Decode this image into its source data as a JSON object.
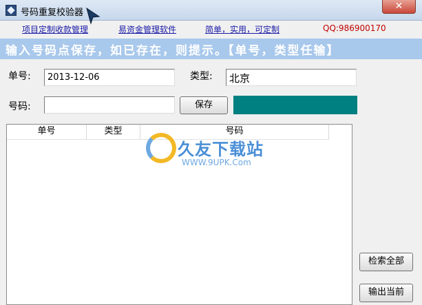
{
  "window": {
    "title": "号码重复校验器",
    "close_symbol": "✕"
  },
  "links": {
    "custom": "项目定制收款管理",
    "finance": "易资金管理软件",
    "slogan": "简单，实用，可定制",
    "qq": "QQ:986900170"
  },
  "banner": "输入号码点保存，如已存在，则提示。【单号，类型任输】",
  "form": {
    "order_label": "单号:",
    "order_value": "2013-12-06",
    "type_label": "类型:",
    "type_value": "北京",
    "number_label": "号码:",
    "number_value": "",
    "save_button": "保存"
  },
  "table": {
    "columns": [
      "单号",
      "类型",
      "号码"
    ]
  },
  "buttons": {
    "search_all": "检索全部",
    "export_current": "输出当前"
  },
  "watermark": {
    "text": "久友下载站",
    "url": "WWW.9UPK.Com"
  },
  "colors": {
    "status_box": "#008080",
    "banner": "#a8c8ec",
    "link": "#1a1aa6",
    "qq": "#c00000"
  }
}
